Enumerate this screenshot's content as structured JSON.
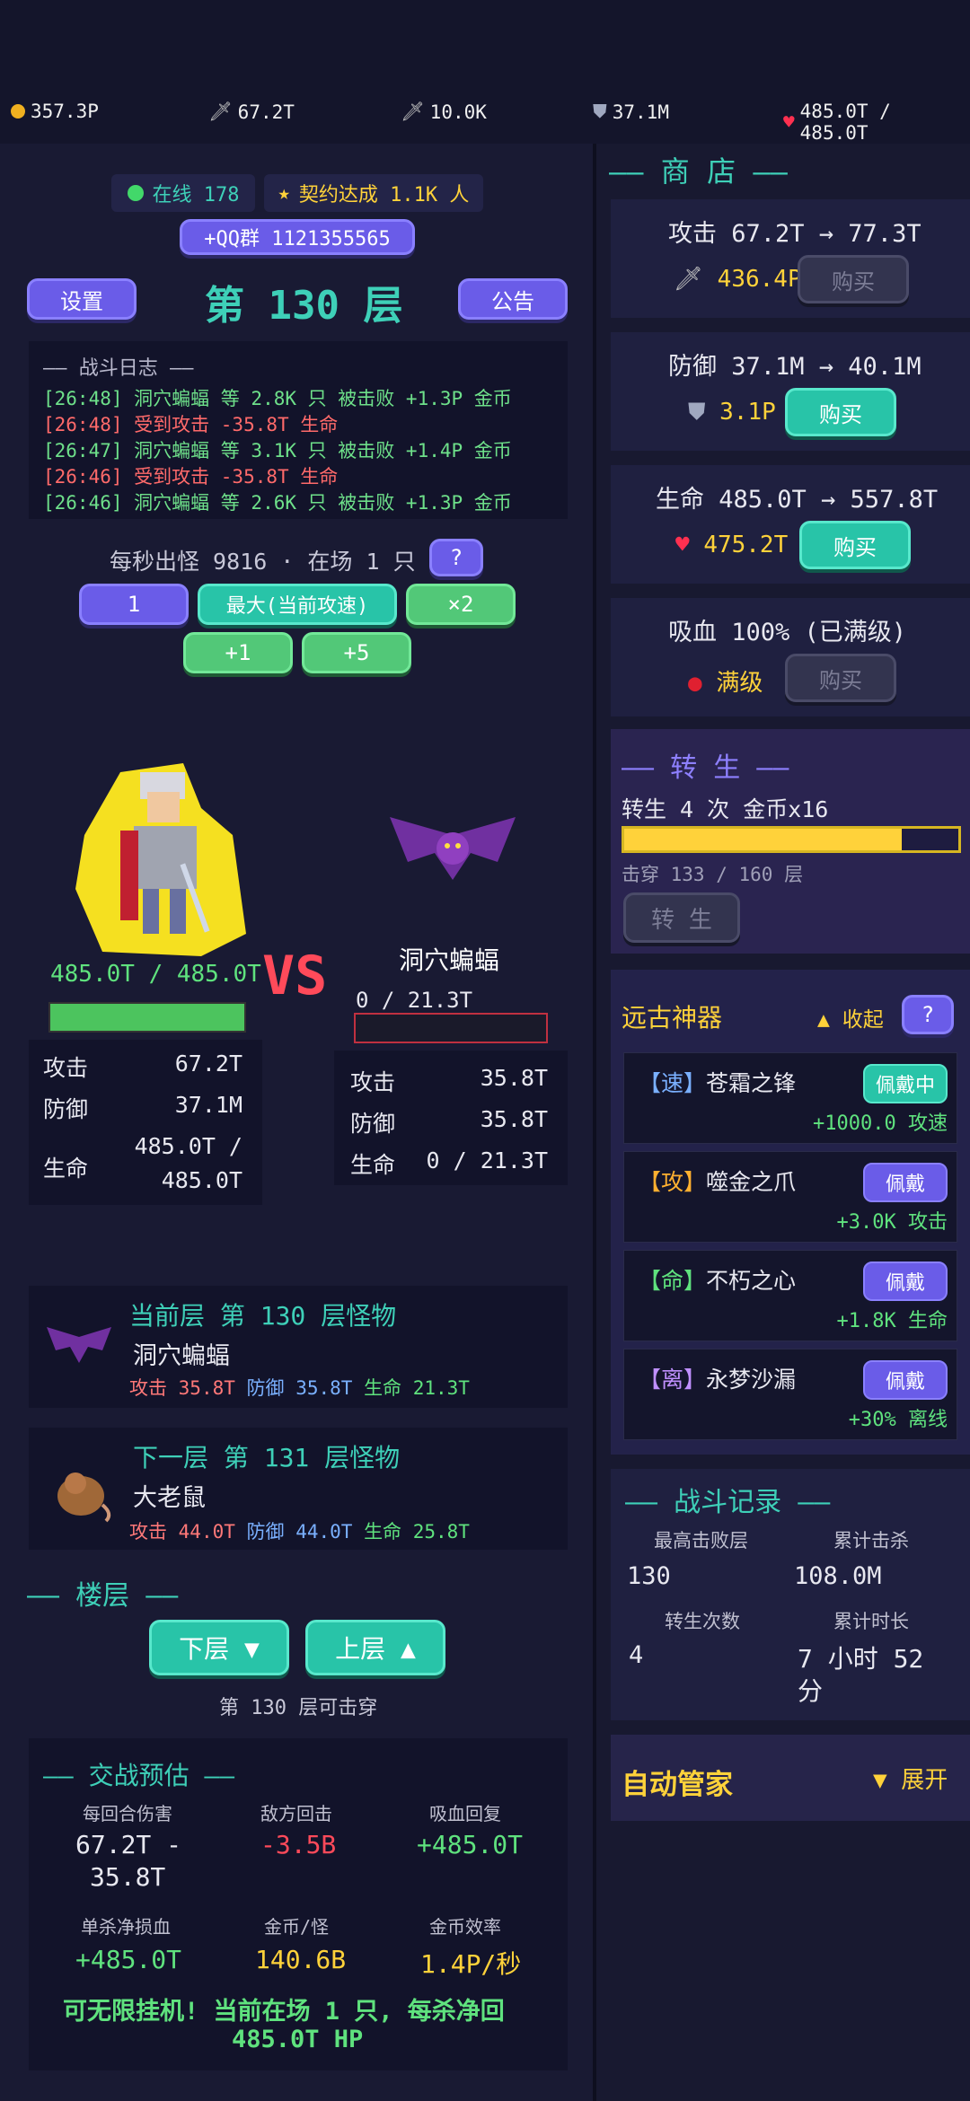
{
  "topbar": {
    "gold": "357.3P",
    "atk1": "67.2T",
    "atk2": "10.0K",
    "def": "37.1M",
    "hp": "485.0T / 485.0T"
  },
  "header": {
    "online": "在线 178",
    "contract": "契约达成 1.1K 人",
    "qq": "+QQ群 1121355565",
    "settings": "设置",
    "floor": "第 130 层",
    "notice": "公告"
  },
  "log": {
    "title": "—— 战斗日志 ——",
    "lines": [
      {
        "t": "[26:48] 洞穴蝙蝠 等 2.8K 只 被击败 +1.3P 金币",
        "kind": "g"
      },
      {
        "t": "[26:48] 受到攻击 -35.8T 生命",
        "kind": "r"
      },
      {
        "t": "[26:47] 洞穴蝙蝠 等 3.1K 只 被击败 +1.4P 金币",
        "kind": "g"
      },
      {
        "t": "[26:46] 受到攻击 -35.8T 生命",
        "kind": "r"
      },
      {
        "t": "[26:46] 洞穴蝙蝠 等 2.6K 只 被击败 +1.3P 金币",
        "kind": "g"
      }
    ]
  },
  "spawn": {
    "info": "每秒出怪 9816 · 在场 1 只",
    "help": "?",
    "b1": "1",
    "bmax": "最大(当前攻速)",
    "bx2": "×2",
    "bp1": "+1",
    "bp5": "+5"
  },
  "battle": {
    "vs": "VS",
    "hero_hp": "485.0T / 485.0T",
    "enemy_name": "洞穴蝙蝠",
    "enemy_hp": "0 / 21.3T",
    "hero_hp_fill": 1.0,
    "enemy_hp_fill": 0.0
  },
  "hero_stats": {
    "atk_l": "攻击",
    "atk": "67.2T",
    "def_l": "防御",
    "def": "37.1M",
    "hp_l": "生命",
    "hp1": "485.0T /",
    "hp2": "485.0T"
  },
  "enemy_stats": {
    "atk_l": "攻击",
    "atk": "35.8T",
    "def_l": "防御",
    "def": "35.8T",
    "hp_l": "生命",
    "hp": "0 / 21.3T"
  },
  "cur_monster": {
    "title": "当前层 第 130 层怪物",
    "name": "洞穴蝙蝠",
    "atk_l": "攻击",
    "atk": "35.8T",
    "def_l": "防御",
    "def": "35.8T",
    "hp_l": "生命",
    "hp": "21.3T"
  },
  "next_monster": {
    "title": "下一层 第 131 层怪物",
    "name": "大老鼠",
    "atk_l": "攻击",
    "atk": "44.0T",
    "def_l": "防御",
    "def": "44.0T",
    "hp_l": "生命",
    "hp": "25.8T"
  },
  "floors": {
    "title": "—— 楼层 ——",
    "down": "下层 ▼",
    "up": "上层 ▲",
    "note": "第 130 层可击穿"
  },
  "estimate": {
    "title": "—— 交战预估 ——",
    "l1": "每回合伤害",
    "v1a": "67.2T -",
    "v1b": "35.8T",
    "l2": "敌方回击",
    "v2": "-3.5B",
    "l3": "吸血回复",
    "v3": "+485.0T",
    "l4": "单杀净损血",
    "v4": "+485.0T",
    "l5": "金币/怪",
    "v5": "140.6B",
    "l6": "金币效率",
    "v6": "1.4P/秒",
    "foot1": "可无限挂机! 当前在场 1 只, 每杀净回",
    "foot2": "485.0T HP"
  },
  "shop": {
    "title": "—— 商 店 ——",
    "buy": "购买",
    "atk": {
      "label": "攻击 67.2T → 77.3T",
      "cost": "436.4P"
    },
    "def": {
      "label": "防御 37.1M → 40.1M",
      "cost": "3.1P"
    },
    "hp": {
      "label": "生命 485.0T → 557.8T",
      "cost": "475.2T"
    },
    "ls": {
      "label": "吸血 100% (已满级)",
      "cost": "满级"
    }
  },
  "rebirth": {
    "title": "—— 转 生 ——",
    "info": "转生 4 次   金币x16",
    "progress": "击穿 133 / 160 层",
    "fill": 0.83,
    "btn": "转 生"
  },
  "artifacts": {
    "title": "远古神器",
    "collapse": "▲ 收起",
    "help": "?",
    "items": [
      {
        "tag": "【速】",
        "name": "苍霜之锋",
        "btn": "佩戴中",
        "bonus": "+1000.0 攻速"
      },
      {
        "tag": "【攻】",
        "name": "噬金之爪",
        "btn": "佩戴",
        "bonus": "+3.0K 攻击"
      },
      {
        "tag": "【命】",
        "name": "不朽之心",
        "btn": "佩戴",
        "bonus": "+1.8K 生命"
      },
      {
        "tag": "【离】",
        "name": "永梦沙漏",
        "btn": "佩戴",
        "bonus": "+30% 离线"
      }
    ]
  },
  "record": {
    "title": "—— 战斗记录 ——",
    "l1": "最高击败层",
    "v1": "130",
    "l2": "累计击杀",
    "v2": "108.0M",
    "l3": "转生次数",
    "v3": "4",
    "l4": "累计时长",
    "v4a": "7 小时 52",
    "v4b": "分"
  },
  "butler": {
    "title": "自动管家",
    "expand": "▼ 展开"
  },
  "colors": {
    "accent_teal": "#3ed0b8",
    "accent_purple": "#6a5ce8",
    "gold": "#ffd23a",
    "danger": "#ff4a5a"
  }
}
